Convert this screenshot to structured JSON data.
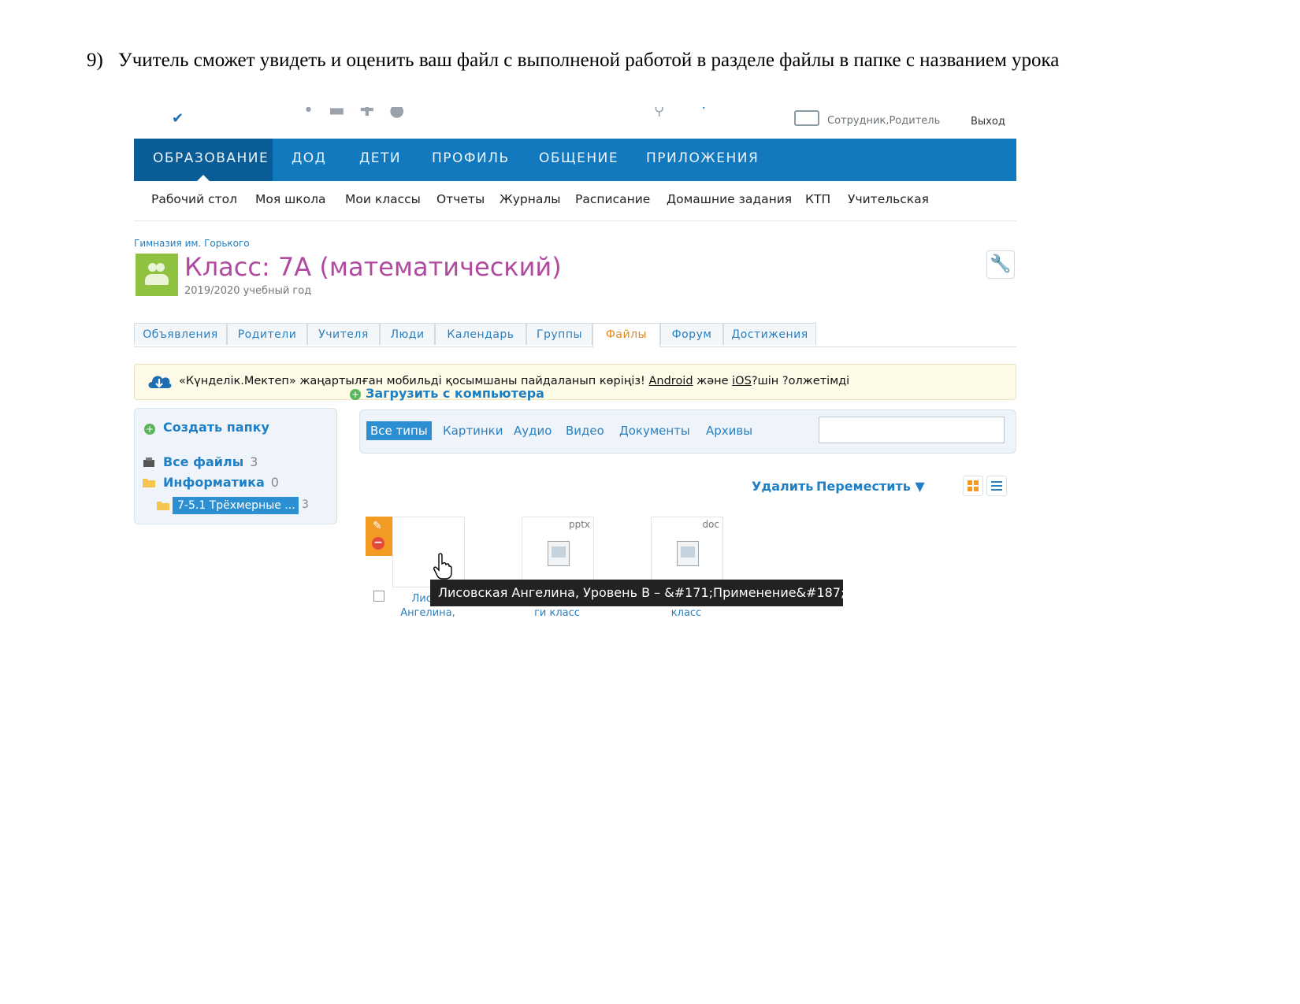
{
  "instruction": {
    "number": "9)",
    "text": "Учитель сможет увидеть и оценить ваш файл с выполненой работой в разделе файлы в папке с названием урока"
  },
  "topbar": {
    "role": "Сотрудник,Родитель",
    "logout": "Выход"
  },
  "main_nav": [
    "ОБРАЗОВАНИЕ",
    "ДОД",
    "ДЕТИ",
    "ПРОФИЛЬ",
    "ОБЩЕНИЕ",
    "ПРИЛОЖЕНИЯ"
  ],
  "sub_nav": [
    "Рабочий стол",
    "Моя школа",
    "Мои классы",
    "Отчеты",
    "Журналы",
    "Расписание",
    "Домашние задания",
    "КТП",
    "Учительская"
  ],
  "school": "Гимназия им. Горького",
  "class_title": "Класс: 7А (математический)",
  "school_year": "2019/2020 учебный год",
  "tabs": [
    "Объявления",
    "Родители",
    "Учителя",
    "Люди",
    "Календарь",
    "Группы",
    "Файлы",
    "Форум",
    "Достижения"
  ],
  "active_tab": "Файлы",
  "notice": {
    "before": "«Күнделік.Мектеп» жаңартылған мобильді қосымшаны пайдаланып көріңіз! ",
    "android": "Android",
    "mid": " және ",
    "ios": "iOS",
    "after": "?шін ?олжетімді"
  },
  "sidebar": {
    "create_folder": "Создать папку",
    "all_files": "Все файлы",
    "all_files_count": "3",
    "informatics": "Информатика",
    "informatics_count": "0",
    "selected_folder": "7-5.1 Трёхмерные ...",
    "selected_count": "3"
  },
  "upload": "Загрузить с компьютера",
  "filters": [
    "Все типы",
    "Картинки",
    "Аудио",
    "Видео",
    "Документы",
    "Архивы"
  ],
  "actions": {
    "delete": "Удалить",
    "move": "Переместить ▼"
  },
  "files": [
    {
      "ext": "",
      "name_line1": "Лисов",
      "name_line2": "Ангелина,"
    },
    {
      "ext": "pptx",
      "name_line1": "",
      "name_line2": "ги класс"
    },
    {
      "ext": "doc",
      "name_line1": "",
      "name_line2": "класс"
    }
  ],
  "tooltip": "Лисовская Ангелина, Уровень В – &#171;Применение&#187;",
  "colors": {
    "nav_blue": "#1279bf",
    "nav_active": "#0a5c97",
    "title_purple": "#b04a9f",
    "link_blue": "#1f7fc4",
    "active_tab_orange": "#e08a1a"
  }
}
